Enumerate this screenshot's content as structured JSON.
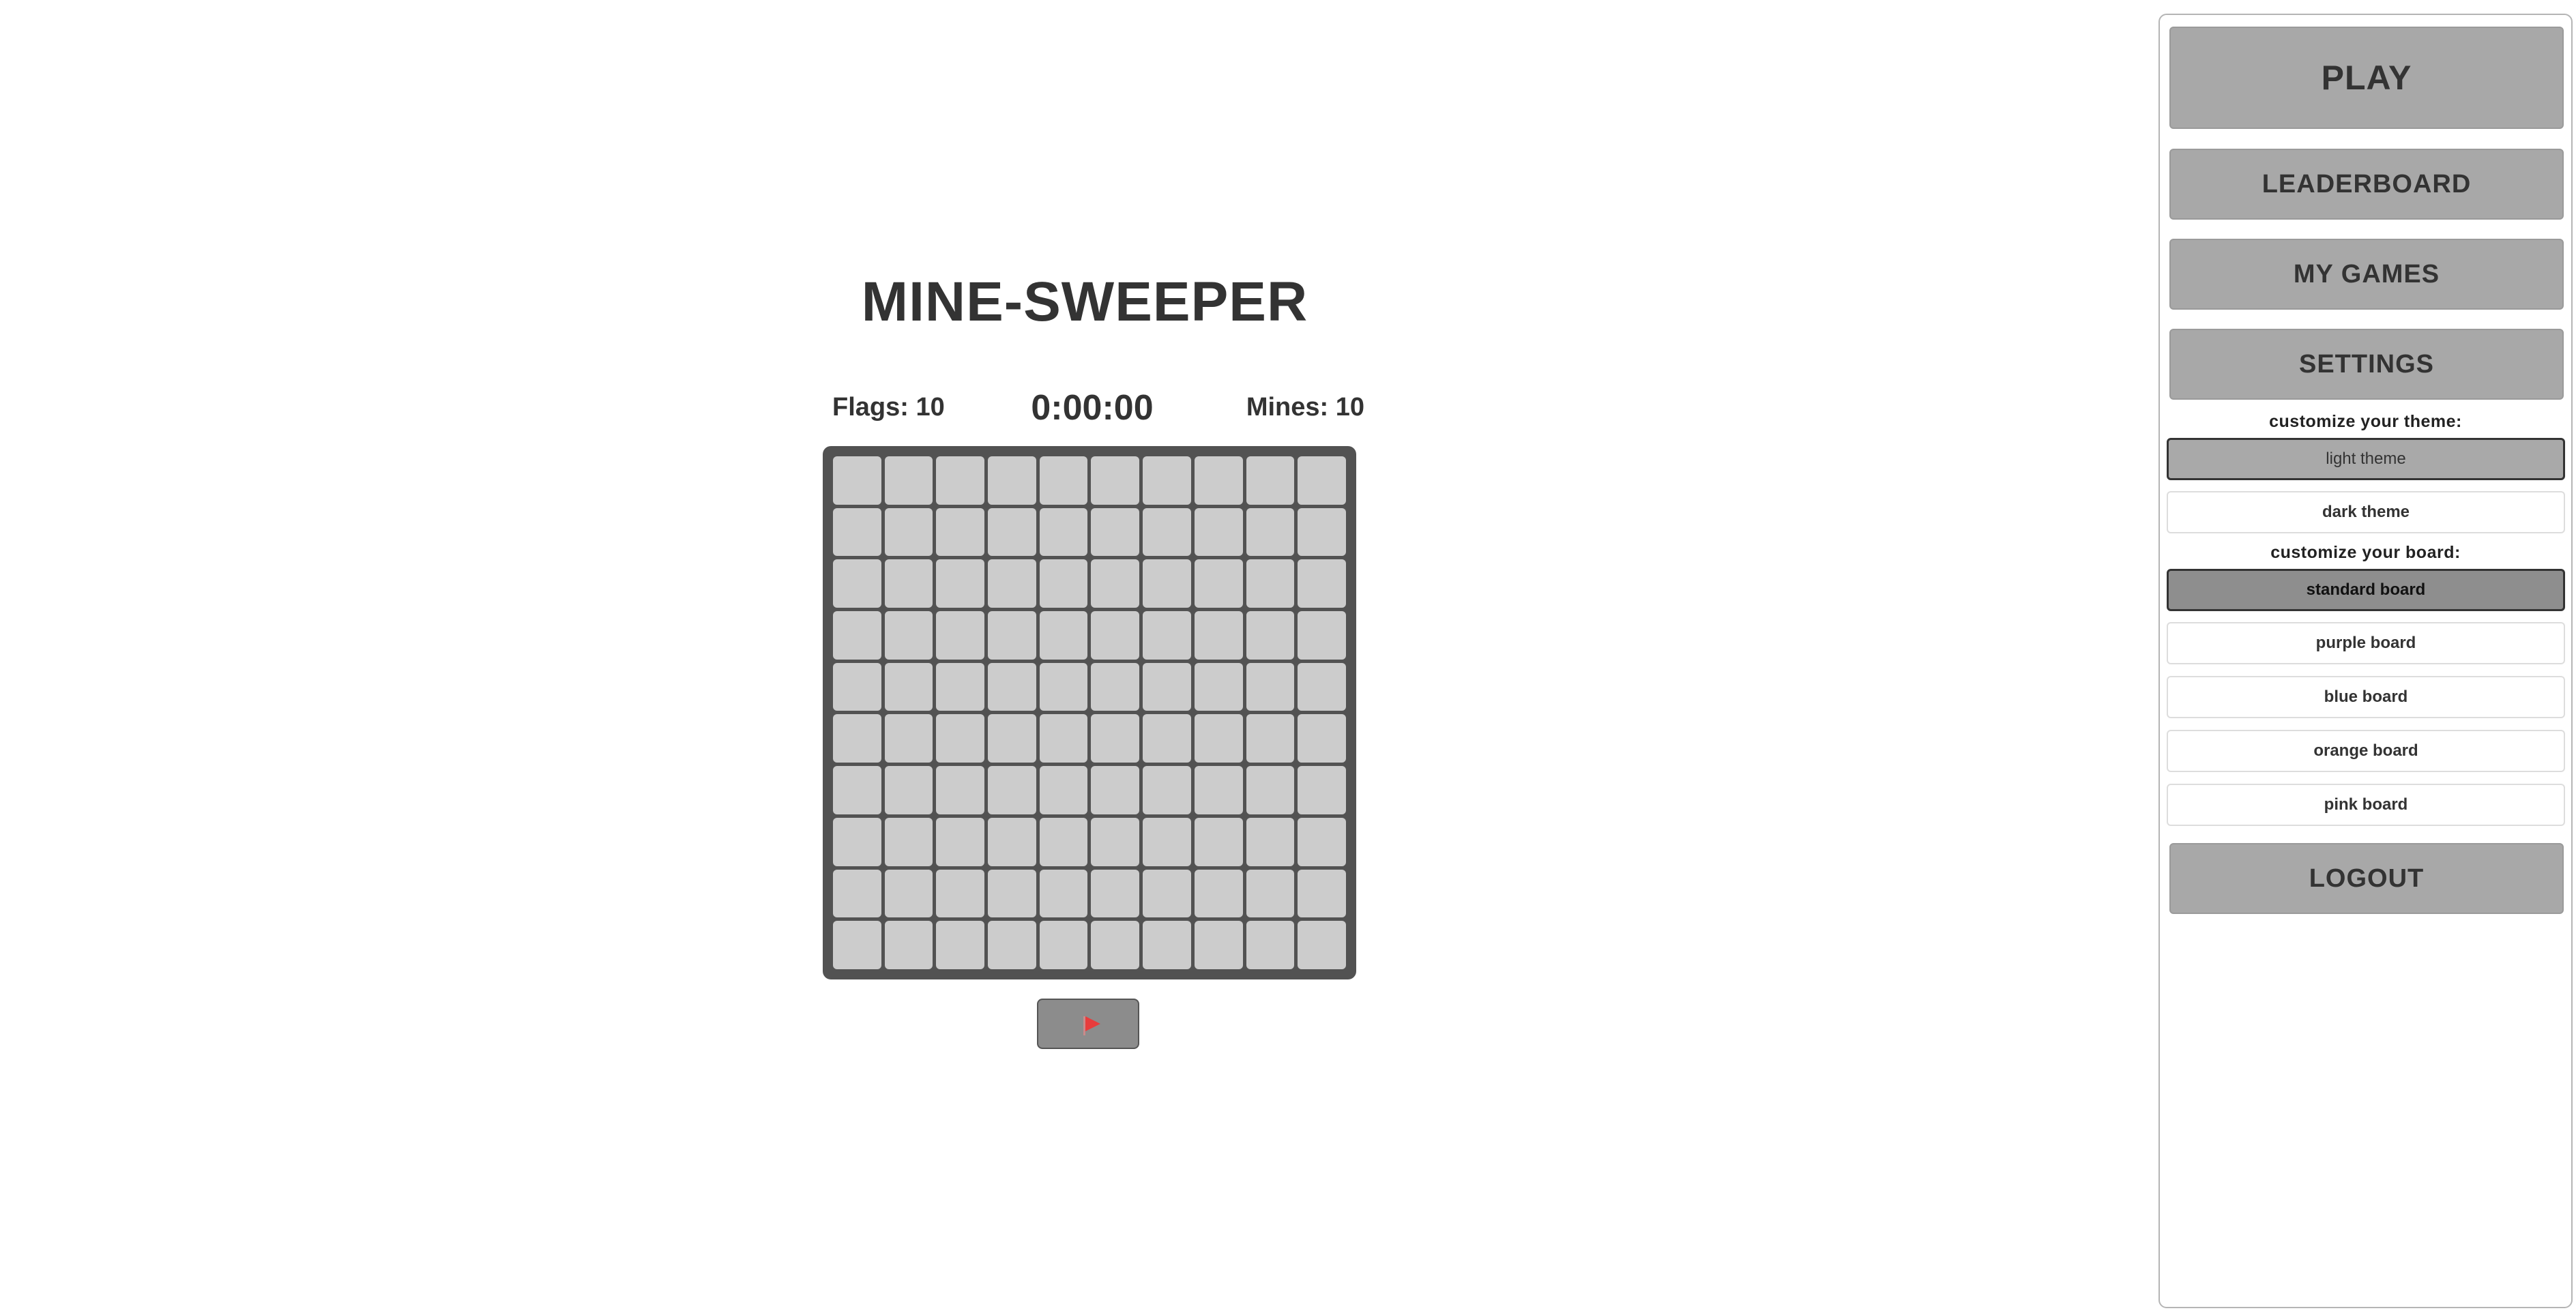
{
  "game": {
    "title": "MINE-SWEEPER",
    "flags_label": "Flags: 10",
    "timer": "0:00:00",
    "mines_label": "Mines: 10",
    "flags": 10,
    "mines": 10,
    "board": {
      "rows": 10,
      "cols": 10,
      "cell_state": "covered"
    },
    "flag_toggle": {
      "icon": "flag-icon",
      "flag_color": "#e83c3c"
    }
  },
  "sidebar": {
    "play": "PLAY",
    "leaderboard": "LEADERBOARD",
    "my_games": "MY GAMES",
    "settings": "SETTINGS",
    "theme_label": "customize your theme:",
    "themes": [
      "light theme",
      "dark theme"
    ],
    "selected_theme": "light theme",
    "board_label": "customize your board:",
    "boards": [
      "standard board",
      "purple board",
      "blue board",
      "orange board",
      "pink board"
    ],
    "selected_board": "standard board",
    "logout": "LOGOUT"
  },
  "colors": {
    "board_frame": "#525252",
    "cell": "#cccccc",
    "button": "#a8a8a8",
    "text": "#333333"
  }
}
